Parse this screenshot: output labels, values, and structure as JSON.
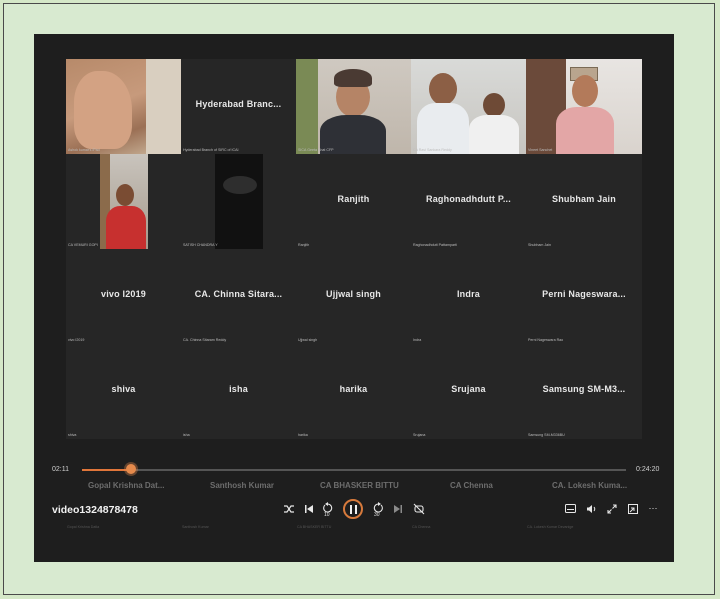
{
  "player": {
    "video_title": "video1324878478",
    "time_current": "02:11",
    "time_total": "0:24:20",
    "progress_fraction": 0.09
  },
  "participants": [
    {
      "name": "",
      "sub": "Ashok kumar's iPad",
      "video": true
    },
    {
      "name": "Hyderabad  Branc...",
      "sub": "Hyderabad Branch of SIRC of ICAI",
      "video": false
    },
    {
      "name": "",
      "sub": "SICA Geeta Bhat CFP",
      "video": true
    },
    {
      "name": "",
      "sub": "CA Ravi Sankara Reddy",
      "video": true
    },
    {
      "name": "",
      "sub": "Vineet Sanchet",
      "video": true
    },
    {
      "name": "",
      "sub": "CA VEMURI GOPI",
      "video": true
    },
    {
      "name": "",
      "sub": "SATISH CHANDRA Y",
      "video": true
    },
    {
      "name": "Ranjith",
      "sub": "Ranjith",
      "video": false
    },
    {
      "name": "Raghonadhdutt  P...",
      "sub": "Raghonadhdutt Pattamparti",
      "video": false
    },
    {
      "name": "Shubham Jain",
      "sub": "Shubham Jain",
      "video": false
    },
    {
      "name": "vivo I2019",
      "sub": "vivo I2019",
      "video": false
    },
    {
      "name": "CA.  Chinna  Sitara...",
      "sub": "CA. Chinna Sitaram Reddy",
      "video": false
    },
    {
      "name": "Ujjwal singh",
      "sub": "Ujjwal singh",
      "video": false
    },
    {
      "name": "Indra",
      "sub": "Indra",
      "video": false
    },
    {
      "name": "Perni  Nageswara...",
      "sub": "Perni Nageswara Rao",
      "video": false
    },
    {
      "name": "shiva",
      "sub": "shiva",
      "video": false
    },
    {
      "name": "isha",
      "sub": "isha",
      "video": false
    },
    {
      "name": "harika",
      "sub": "harika",
      "video": false
    },
    {
      "name": "Srujana",
      "sub": "Srujana",
      "video": false
    },
    {
      "name": "Samsung  SM-M3...",
      "sub": "Samsung SM-M336BU",
      "video": false
    }
  ],
  "bottom_strip": [
    {
      "name": "Gopal  Krishna  Dat...",
      "sub": "Gopal Krishna Datla"
    },
    {
      "name": "Santhosh Kumar",
      "sub": "Santhosh Kumar"
    },
    {
      "name": "CA  BHASKER  BITTU",
      "sub": "CA BHASKER BITTU"
    },
    {
      "name": "CA Chenna",
      "sub": "CA Chenna"
    },
    {
      "name": "CA.  Lokesh  Kuma...",
      "sub": "CA. Lokesh Kumar Devanige"
    }
  ],
  "controls": {
    "shuffle_icon": "shuffle-icon",
    "previous_icon": "skip-previous-icon",
    "rewind_label": "10",
    "forward_label": "30",
    "next_icon": "skip-next-icon",
    "repeat_icon": "repeat-off-icon",
    "more_label": "···"
  },
  "colors": {
    "accent": "#e0763a",
    "player_bg": "#1e1e1e",
    "page_bg": "#d5e8c8"
  }
}
